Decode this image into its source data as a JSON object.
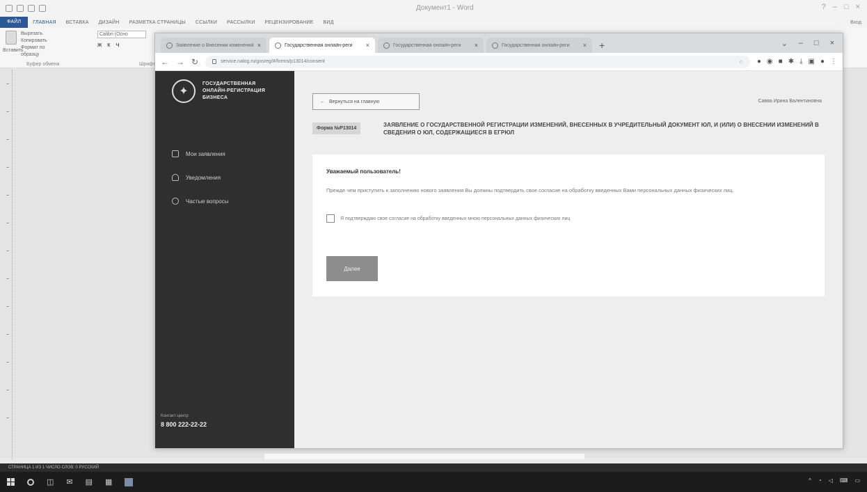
{
  "word": {
    "title": "Документ1 - Word",
    "tabs": [
      "ФАЙЛ",
      "ГЛАВНАЯ",
      "ВСТАВКА",
      "ДИЗАЙН",
      "РАЗМЕТКА СТРАНИЦЫ",
      "ССЫЛКИ",
      "РАССЫЛКИ",
      "РЕЦЕНЗИРОВАНИЕ",
      "ВИД"
    ],
    "share": "Вход",
    "ribbon": {
      "paste": "Вставить",
      "cut": "Вырезать",
      "copy": "Копировать",
      "format_painter": "Формат по образцу",
      "font_name": "Calibri (Осно",
      "clipboard_label": "Буфер обмена",
      "font_label": "Шрифт"
    },
    "status": "СТРАНИЦА 1 ИЗ 1   ЧИСЛО СЛОВ: 0   РУССКИЙ"
  },
  "browser": {
    "tabs": [
      {
        "title": "Заявление о Внесении изменений"
      },
      {
        "title": "Государственная онлайн-реги"
      },
      {
        "title": "Государственная онлайн-реги"
      },
      {
        "title": "Государственная онлайн-реги"
      }
    ],
    "new_tab": "+",
    "url": "service.nalog.ru/gosreg/#/forms/p13014/consent"
  },
  "sidebar": {
    "logo_text": "ГОСУДАРСТВЕННАЯ ОНЛАЙН-РЕГИСТРАЦИЯ БИЗНЕСА",
    "nav": [
      {
        "label": "Мои заявления"
      },
      {
        "label": "Уведомления"
      },
      {
        "label": "Частые вопросы"
      }
    ],
    "support_label": "Контакт-центр",
    "support_phone": "8 800 222-22-22"
  },
  "content": {
    "back_button": "Вернуться на главную",
    "user_name": "Савва Ирина Валентиновна",
    "form_badge": "Форма №Р13014",
    "form_title": "ЗАЯВЛЕНИЕ О ГОСУДАРСТВЕННОЙ РЕГИСТРАЦИИ ИЗМЕНЕНИЙ, ВНЕСЕННЫХ В УЧРЕДИТЕЛЬНЫЙ ДОКУМЕНТ ЮЛ, И (ИЛИ) О ВНЕСЕНИИ ИЗМЕНЕНИЙ В СВЕДЕНИЯ О ЮЛ, СОДЕРЖАЩИЕСЯ В ЕГРЮЛ",
    "card": {
      "heading": "Уважаемый пользователь!",
      "text": "Прежде чем приступить к заполнению нового заявления Вы должны подтвердить свое согласие на обработку введенных Вами персональных данных физических лиц.",
      "consent": "Я подтверждаю свое согласие на обработку введенных мною персональных данных физических лиц",
      "next_button": "Далее"
    }
  }
}
